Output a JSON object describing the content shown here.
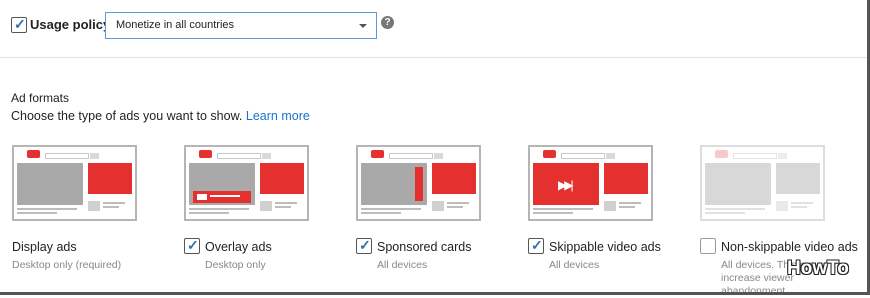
{
  "usage_policy": {
    "checked": true,
    "label": "Usage policy",
    "select_value": "Monetize in all countries",
    "help_icon": "help-circle-icon"
  },
  "ad_formats": {
    "title": "Ad formats",
    "description": "Choose the type of ads you want to show.",
    "learn_more": "Learn more",
    "options": [
      {
        "label": "Display ads",
        "sub": "Desktop only (required)",
        "checkbox": false,
        "checked": true
      },
      {
        "label": "Overlay ads",
        "sub": "Desktop only",
        "checkbox": true,
        "checked": true
      },
      {
        "label": "Sponsored cards",
        "sub": "All devices",
        "checkbox": true,
        "checked": true
      },
      {
        "label": "Skippable video ads",
        "sub": "All devices",
        "checkbox": true,
        "checked": true
      },
      {
        "label": "Non-skippable video ads",
        "sub": "All devices. This may increase viewer abandonment",
        "checkbox": true,
        "checked": false
      }
    ]
  },
  "thumbnail": {
    "logo_text": "You",
    "logo_text2": "Tube"
  },
  "watermark": "HowTo",
  "colors": {
    "accent_red": "#e53030",
    "link_blue": "#1a73c8",
    "check_blue": "#2f6fb0",
    "select_border": "#5a9bd8"
  }
}
